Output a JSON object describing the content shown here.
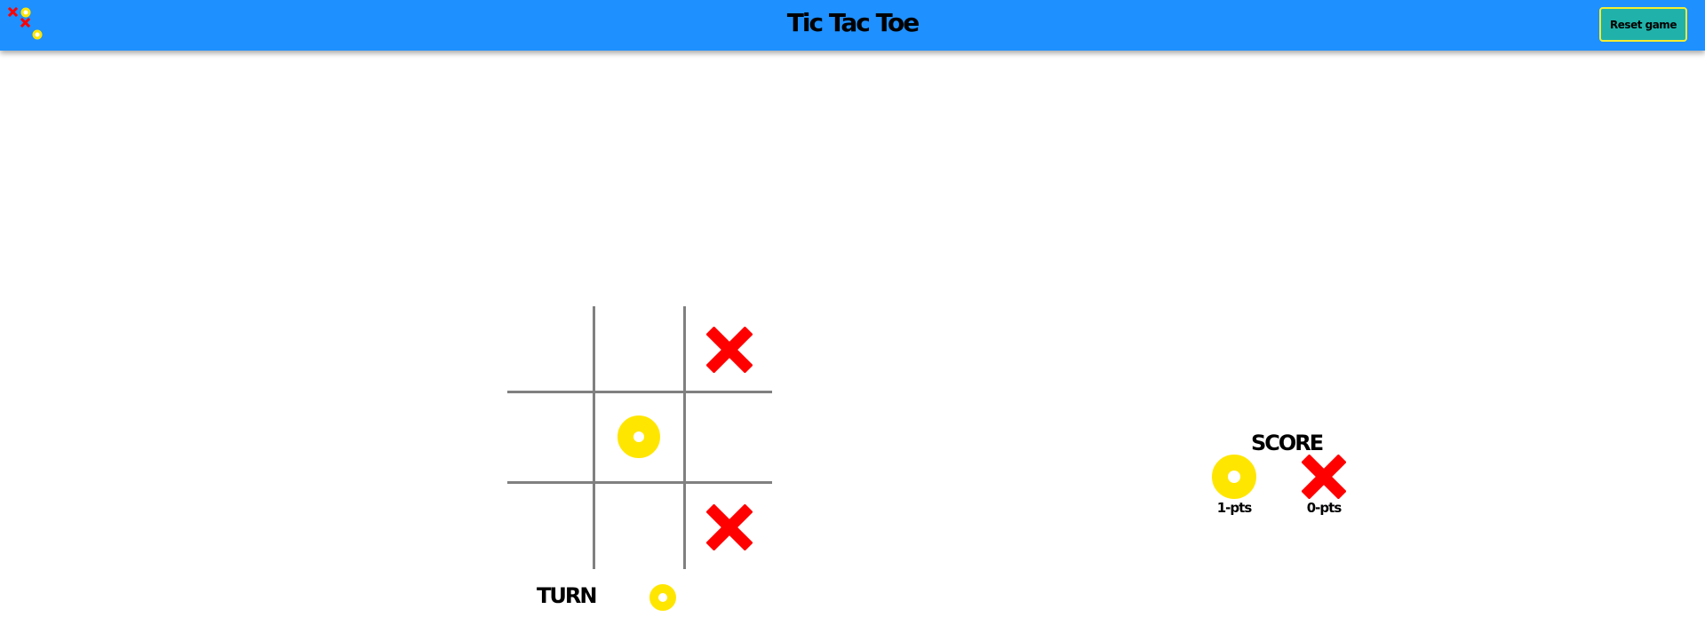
{
  "header": {
    "title": "Tic Tac Toe",
    "reset_label": "Reset game",
    "background_color": "#1e90ff"
  },
  "board": {
    "cells": [
      "",
      "",
      "X",
      "",
      "O",
      "",
      "",
      "",
      "X"
    ]
  },
  "turn": {
    "label": "TURN",
    "current": "O"
  },
  "score": {
    "title": "SCORE",
    "o_points": "1-pts",
    "x_points": "0-pts"
  },
  "colors": {
    "x_mark": "#ff0000",
    "o_mark": "#ffe600",
    "grid": "#808080",
    "reset_button": "#20b2aa",
    "reset_border": "#f5ee30"
  }
}
